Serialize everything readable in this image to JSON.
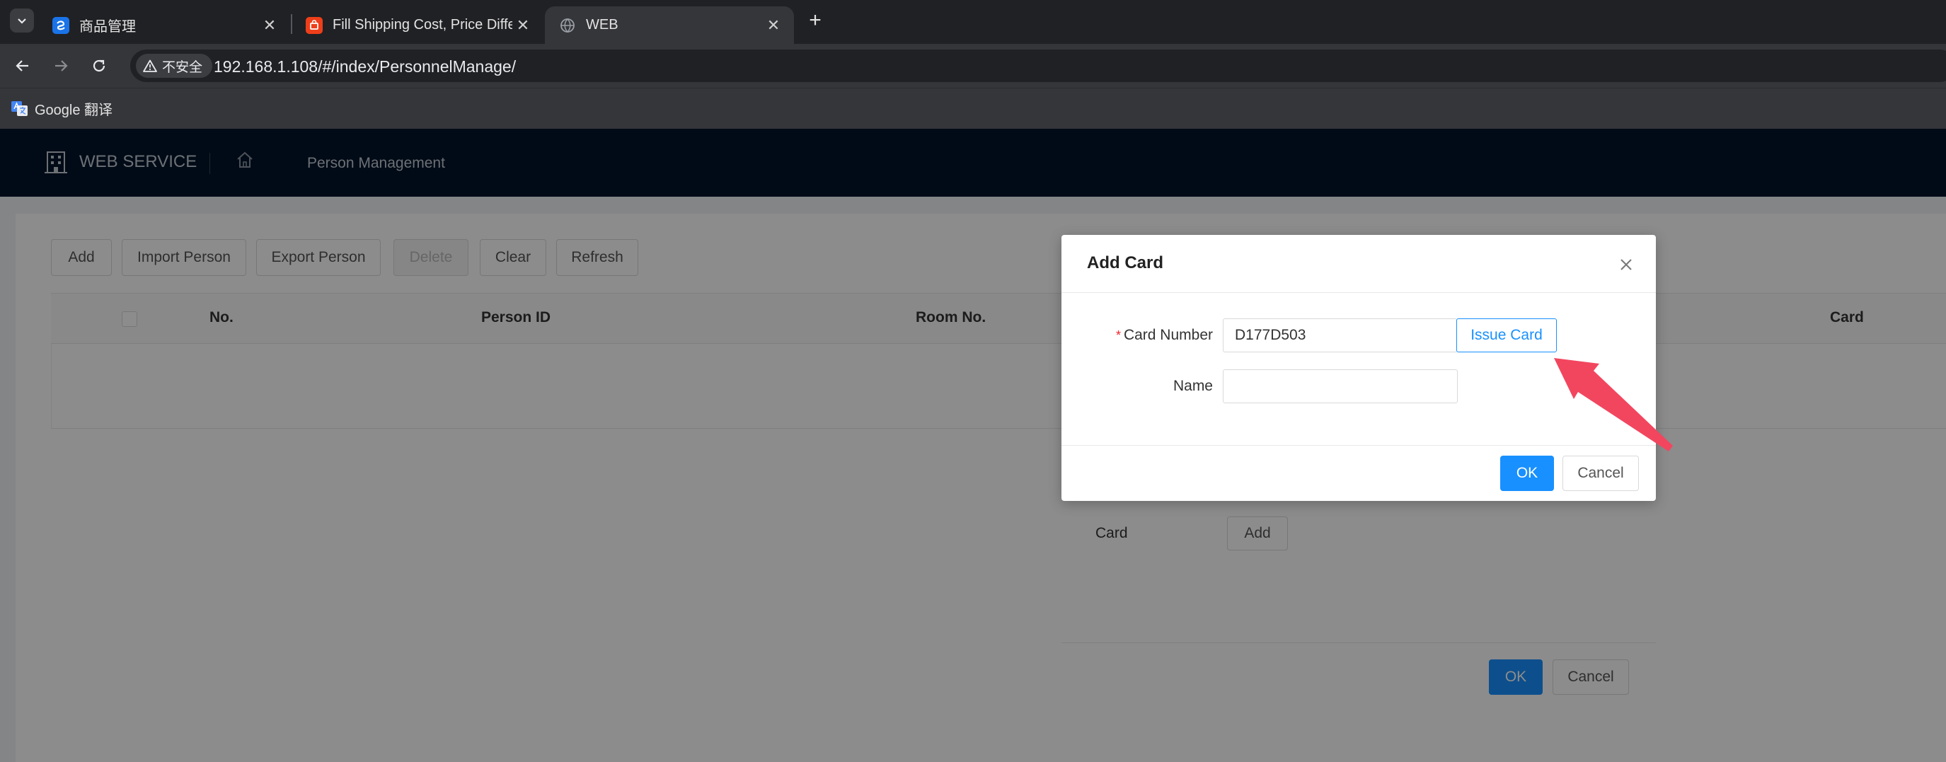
{
  "browser": {
    "tabs": [
      {
        "title": "商品管理",
        "active": false
      },
      {
        "title": "Fill Shipping Cost, Price Difference",
        "active": false
      },
      {
        "title": "WEB",
        "active": true
      }
    ],
    "security_label": "不安全",
    "url": "192.168.1.108/#/index/PersonnelManage/",
    "bookmarks": [
      {
        "label": "Google 翻译"
      }
    ]
  },
  "app": {
    "brand": "WEB SERVICE",
    "breadcrumb": "Person Management",
    "toolbar": {
      "add": "Add",
      "import": "Import Person",
      "export": "Export Person",
      "delete": "Delete",
      "clear": "Clear",
      "refresh": "Refresh"
    },
    "table": {
      "columns": [
        "No.",
        "Person ID",
        "Room No.",
        "Card"
      ]
    }
  },
  "underlying_modal": {
    "card_label": "Card",
    "card_add": "Add",
    "ok": "OK",
    "cancel": "Cancel"
  },
  "add_card_modal": {
    "title": "Add Card",
    "card_number_label": "Card Number",
    "card_number_value": "D177D503",
    "issue_card": "Issue Card",
    "name_label": "Name",
    "name_value": "",
    "ok": "OK",
    "cancel": "Cancel"
  },
  "colors": {
    "primary": "#1890ff",
    "header_bg": "#00152b",
    "annotation_arrow": "#f2465f"
  }
}
